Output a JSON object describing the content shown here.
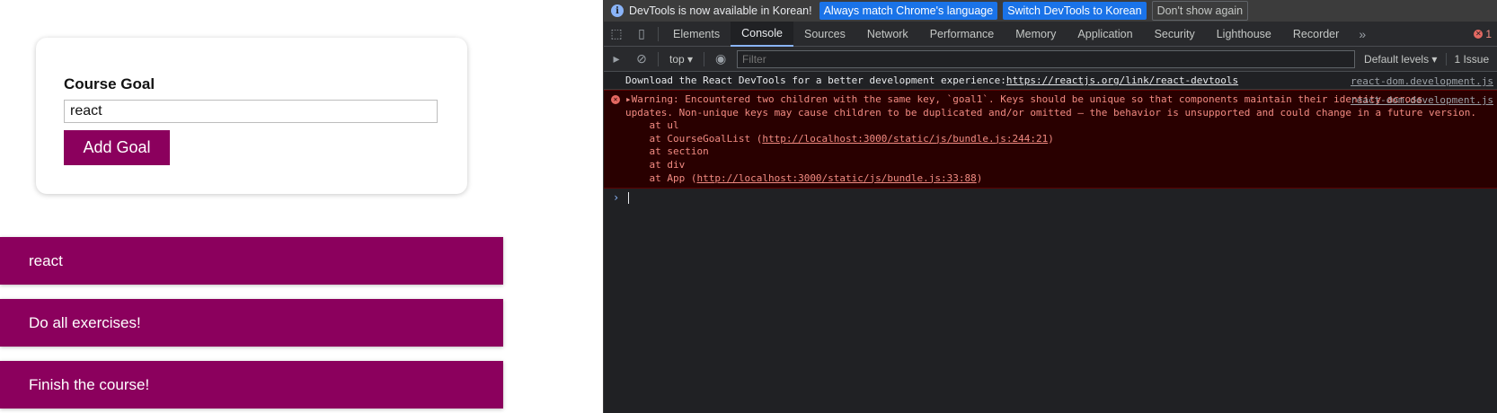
{
  "app": {
    "form": {
      "label": "Course Goal",
      "input_value": "react",
      "button_label": "Add Goal"
    },
    "goals": [
      "react",
      "Do all exercises!",
      "Finish the course!"
    ],
    "colors": {
      "accent": "#8b005d"
    }
  },
  "devtools": {
    "infobar": {
      "message": "DevTools is now available in Korean!",
      "btn_match": "Always match Chrome's language",
      "btn_switch": "Switch DevTools to Korean",
      "btn_dismiss": "Don't show again"
    },
    "tabs": [
      "Elements",
      "Console",
      "Sources",
      "Network",
      "Performance",
      "Memory",
      "Application",
      "Security",
      "Lighthouse",
      "Recorder"
    ],
    "active_tab": "Console",
    "error_count": "1",
    "toolbar": {
      "context": "top",
      "filter_placeholder": "Filter",
      "levels": "Default levels",
      "issues": "1 Issue"
    },
    "console": {
      "info_prefix": "Download the React DevTools for a better development experience: ",
      "info_link": "https://reactjs.org/link/react-devtools",
      "info_source": "react-dom.development.js",
      "error_line1": "Warning: Encountered two children with the same key, `goal1`. Keys should be unique so that components maintain their identity across",
      "error_line2": "updates. Non-unique keys may cause children to be duplicated and/or omitted — the behavior is unsupported and could change in a future version.",
      "error_at_ul": "    at ul",
      "error_at_list_prefix": "    at CourseGoalList (",
      "error_at_list_link": "http://localhost:3000/static/js/bundle.js:244:21",
      "error_at_section": "    at section",
      "error_at_div": "    at div",
      "error_at_app_prefix": "    at App (",
      "error_at_app_link": "http://localhost:3000/static/js/bundle.js:33:88",
      "close_paren": ")",
      "error_source": "react-dom.development.js"
    }
  }
}
